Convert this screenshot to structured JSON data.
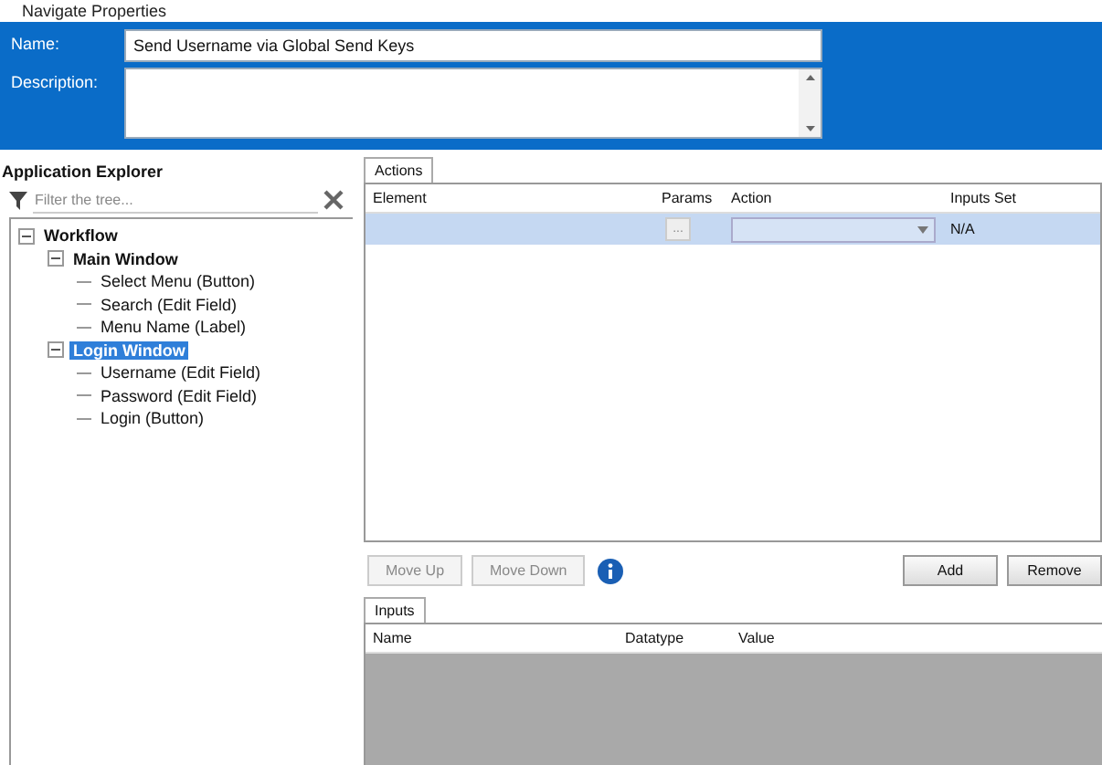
{
  "window": {
    "title": "Navigate Properties"
  },
  "form": {
    "name_label": "Name:",
    "name_value": "Send Username via Global Send Keys",
    "description_label": "Description:"
  },
  "explorer": {
    "title": "Application Explorer",
    "filter_placeholder": "Filter the tree...",
    "tree": [
      {
        "label": "Workflow",
        "expanded": true,
        "selected": false,
        "children": [
          {
            "label": "Main Window",
            "expanded": true,
            "selected": false,
            "children": [
              {
                "label": "Select Menu (Button)",
                "selected": false
              },
              {
                "label": "Search (Edit Field)",
                "selected": false
              },
              {
                "label": "Menu Name (Label)",
                "selected": false
              }
            ]
          },
          {
            "label": "Login Window",
            "expanded": true,
            "selected": true,
            "children": [
              {
                "label": "Username (Edit Field)",
                "selected": false
              },
              {
                "label": "Password (Edit Field)",
                "selected": false
              },
              {
                "label": "Login (Button)",
                "selected": false
              }
            ]
          }
        ]
      }
    ]
  },
  "actions": {
    "tab": "Actions",
    "columns": [
      "Element",
      "Params",
      "Action",
      "Inputs Set"
    ],
    "rows": [
      {
        "element": "",
        "params": "...",
        "inputs_set": "N/A",
        "selected": true
      }
    ]
  },
  "buttons": [
    {
      "label": "Move Up",
      "disabled": true
    },
    {
      "label": "Move Down",
      "disabled": true
    },
    {
      "label": "Add",
      "disabled": false
    },
    {
      "label": "Remove",
      "disabled": false
    }
  ],
  "inputs": {
    "tab": "Inputs",
    "columns": [
      "Name",
      "Datatype",
      "Value"
    ]
  }
}
